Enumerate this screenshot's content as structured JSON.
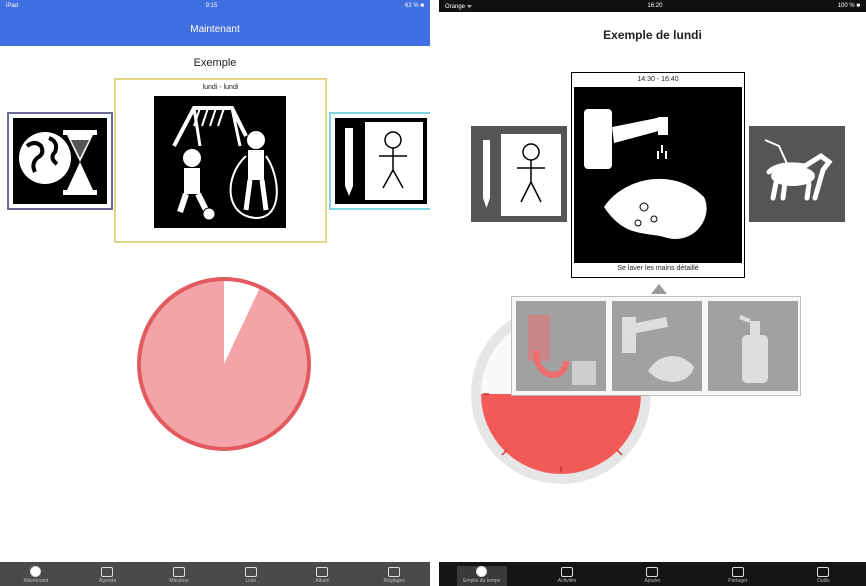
{
  "left": {
    "status": {
      "carrier": "iPad",
      "time": "9:15",
      "battery": "62 % ■"
    },
    "nav_title": "Maintenant",
    "title": "Exemple",
    "center_caption": "lundi - lundi",
    "tabs": [
      {
        "label": "Maintenant",
        "icon": "clock-icon",
        "active": true
      },
      {
        "label": "Agenda",
        "icon": "calendar-icon",
        "active": false
      },
      {
        "label": "Minuteur",
        "icon": "timer-icon",
        "active": false
      },
      {
        "label": "Liste",
        "icon": "list-icon",
        "active": false
      },
      {
        "label": "Album",
        "icon": "album-icon",
        "active": false
      },
      {
        "label": "Réglages",
        "icon": "settings-icon",
        "active": false
      }
    ],
    "timer": {
      "remaining_fraction": 0.93,
      "color": "#f4a3a6",
      "border": "#e05a5f"
    }
  },
  "right": {
    "status": {
      "carrier": "Orange ᯤ",
      "time": "16:20",
      "battery": "100 % ■"
    },
    "title": "Exemple de lundi",
    "center_time": "14:30 - 16:40",
    "center_caption": "Se laver les mains détaillé",
    "tabs": [
      {
        "label": "Emploi du temps",
        "icon": "calendar-icon",
        "active": true
      },
      {
        "label": "Activités",
        "icon": "list-icon",
        "active": false
      },
      {
        "label": "Ajouter",
        "icon": "add-icon",
        "active": false
      },
      {
        "label": "Partager",
        "icon": "share-icon",
        "active": false
      },
      {
        "label": "Outils",
        "icon": "tools-icon",
        "active": false
      }
    ],
    "timer": {
      "remaining_fraction": 0.5,
      "color": "#f25a57"
    }
  }
}
